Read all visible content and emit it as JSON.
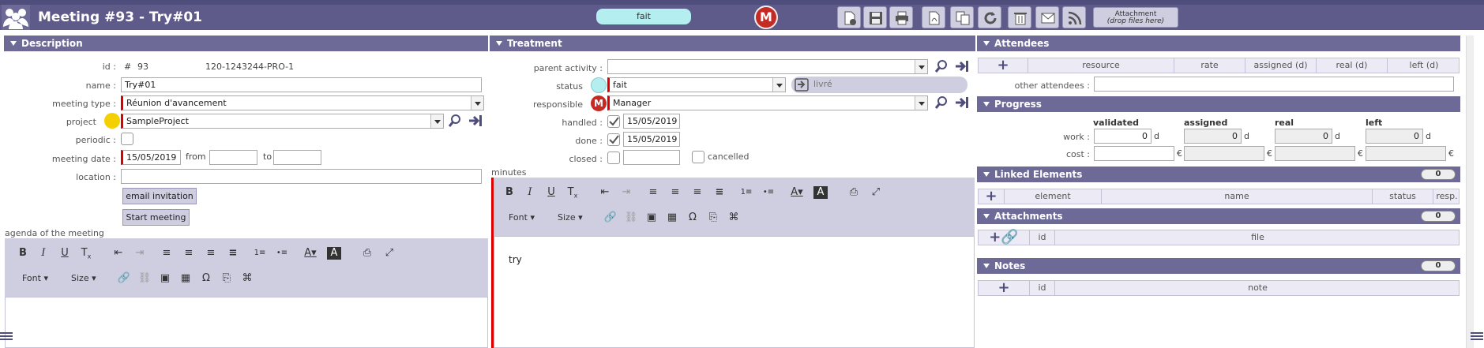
{
  "header": {
    "title": "Meeting #93 - Try#01",
    "status_pill": "fait",
    "user_initial": "M",
    "attachment_btn_line1": "Attachment",
    "attachment_btn_line2": "(drop files here)",
    "toolbar_icons": [
      "new-icon",
      "save-icon",
      "print-icon",
      "pdf-icon",
      "copy-icon",
      "refresh-icon",
      "delete-icon",
      "email-icon",
      "rss-icon"
    ]
  },
  "description": {
    "title": "Description",
    "id_label": "id :",
    "id_hash": "#",
    "id_value": "93",
    "reference": "120-1243244-PRO-1",
    "name_label": "name :",
    "name_value": "Try#01",
    "meeting_type_label": "meeting type :",
    "meeting_type_value": "Réunion d'avancement",
    "project_label": "project",
    "project_value": "SampleProject",
    "periodic_label": "periodic :",
    "meeting_date_label": "meeting date :",
    "meeting_date_value": "15/05/2019",
    "from_label": "from",
    "to_label": "to",
    "location_label": "location :",
    "email_invitation_btn": "email invitation",
    "start_meeting_btn": "Start meeting",
    "agenda_label": "agenda of the meeting"
  },
  "editor": {
    "font_label": "Font",
    "size_label": "Size"
  },
  "treatment": {
    "title": "Treatment",
    "parent_activity_label": "parent activity :",
    "status_label": "status",
    "status_value": "fait",
    "delivered_label": "livré",
    "responsible_label": "responsible",
    "responsible_initial": "M",
    "responsible_value": "Manager",
    "handled_label": "handled :",
    "handled_value": "15/05/2019",
    "done_label": "done :",
    "done_value": "15/05/2019",
    "closed_label": "closed :",
    "cancelled_label": "cancelled",
    "minutes_label": "minutes",
    "minutes_text": "try"
  },
  "attendees": {
    "title": "Attendees",
    "columns": [
      "resource",
      "rate",
      "assigned (d)",
      "real (d)",
      "left (d)"
    ],
    "other_attendees_label": "other attendees :"
  },
  "progress": {
    "title": "Progress",
    "columns": [
      "validated",
      "assigned",
      "real",
      "left"
    ],
    "work_label": "work :",
    "cost_label": "cost :",
    "work_values": [
      "0",
      "0",
      "0",
      "0"
    ],
    "work_unit": "d",
    "cost_unit": "€"
  },
  "linked": {
    "title": "Linked Elements",
    "count": "0",
    "columns": [
      "element",
      "name",
      "status",
      "resp."
    ]
  },
  "attachments": {
    "title": "Attachments",
    "count": "0",
    "columns": [
      "id",
      "file"
    ]
  },
  "notes": {
    "title": "Notes",
    "count": "0",
    "columns": [
      "id",
      "note"
    ]
  },
  "colors": {
    "header_bg": "#5e5b8b",
    "section_bg": "#6d6a98",
    "status_done": "#b4eef0",
    "project_color": "#f5d000",
    "required": "#d00000",
    "avatar": "#c62a25"
  }
}
